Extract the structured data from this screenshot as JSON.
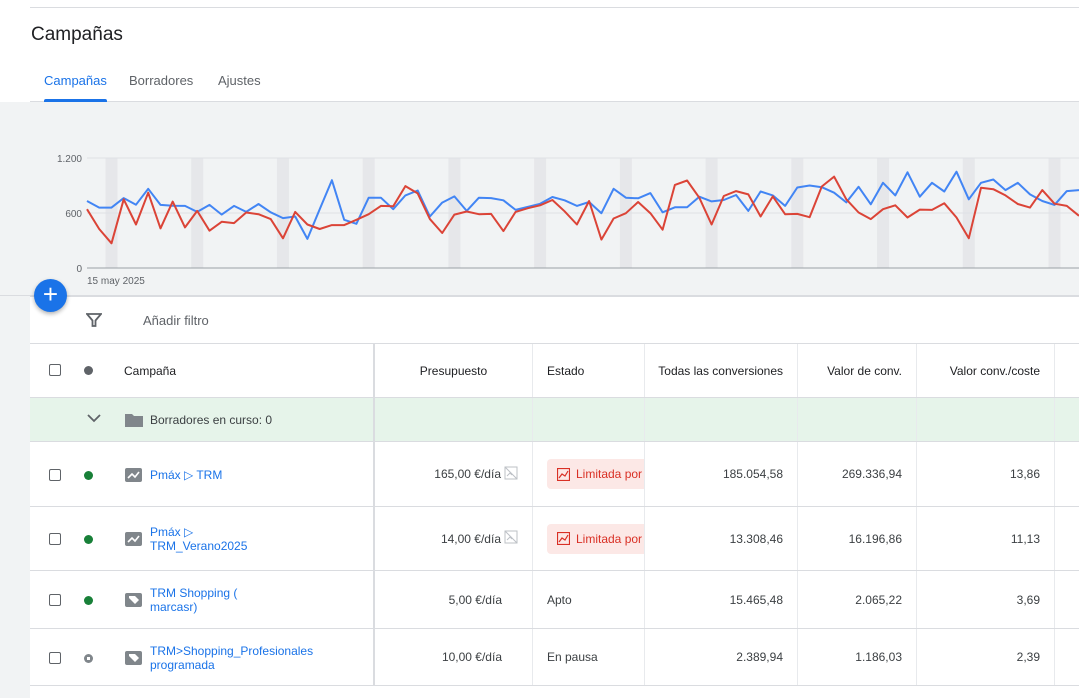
{
  "header": {
    "title": "Campañas"
  },
  "tabs": [
    {
      "label": "Campañas",
      "active": true
    },
    {
      "label": "Borradores"
    },
    {
      "label": "Ajustes"
    }
  ],
  "colors": {
    "accent": "#1a73e8",
    "series_blue": "#4285f4",
    "series_red": "#db4437",
    "enabled": "#188038",
    "paused": "#80868b",
    "limited_bg": "#fce8e6",
    "limited_text": "#d93025"
  },
  "chart_data": {
    "type": "line",
    "x_start_label": "15 may 2025",
    "x_start": "2025-05-15",
    "yticks": [
      "0",
      "600",
      "1.200"
    ],
    "ylim": [
      0,
      1200
    ],
    "weekend_bands": true,
    "series": [
      {
        "color": "#4285f4",
        "values": [
          731,
          659,
          659,
          763,
          691,
          864,
          688,
          680,
          677,
          612,
          688,
          583,
          677,
          612,
          698,
          608,
          544,
          562,
          317,
          640,
          958,
          526,
          482,
          767,
          767,
          641,
          792,
          846,
          562,
          713,
          781,
          623,
          767,
          763,
          738,
          634,
          666,
          700,
          774,
          738,
          677,
          720,
          598,
          864,
          767,
          760,
          817,
          608,
          662,
          662,
          778,
          727,
          742,
          796,
          623,
          835,
          792,
          677,
          878,
          900,
          882,
          821,
          716,
          886,
          695,
          929,
          792,
          1044,
          778,
          929,
          835,
          1051,
          749,
          929,
          965,
          850,
          929,
          803,
          731,
          688,
          839,
          850
        ]
      },
      {
        "color": "#db4437",
        "values": [
          641,
          425,
          270,
          749,
          475,
          821,
          432,
          724,
          443,
          623,
          407,
          504,
          490,
          605,
          587,
          533,
          324,
          612,
          475,
          425,
          468,
          468,
          526,
          587,
          677,
          673,
          893,
          814,
          533,
          382,
          583,
          616,
          587,
          590,
          403,
          612,
          652,
          684,
          742,
          619,
          475,
          731,
          310,
          540,
          598,
          720,
          598,
          418,
          907,
          954,
          767,
          475,
          785,
          839,
          803,
          562,
          781,
          587,
          590,
          554,
          889,
          997,
          749,
          605,
          533,
          641,
          684,
          551,
          637,
          634,
          706,
          551,
          324,
          875,
          860,
          792,
          698,
          659,
          850,
          702,
          677,
          569
        ]
      }
    ]
  },
  "fab": {
    "label": "+"
  },
  "filter": {
    "label": "Añadir filtro"
  },
  "table": {
    "columns": [
      "Campaña",
      "Presupuesto",
      "Estado",
      "Todas las conversiones",
      "Valor de conv.",
      "Valor conv./coste"
    ],
    "drafts_label": "Borradores en curso: 0",
    "rows": [
      {
        "name": "Pmáx ▷ TRM",
        "type": "pmax",
        "status": "enabled",
        "budget": "165,00 €/día",
        "estado": "Limitada por",
        "limited": true,
        "conv": "185.054,58",
        "value": "269.336,94",
        "roas": "13,86"
      },
      {
        "name": "Pmáx ▷ TRM_Verano2025",
        "type": "pmax",
        "status": "enabled",
        "budget": "14,00 €/día",
        "estado": "Limitada por",
        "limited": true,
        "conv": "13.308,46",
        "value": "16.196,86",
        "roas": "11,13"
      },
      {
        "name": "TRM Shopping ( marcasr)",
        "type": "shopping",
        "status": "enabled",
        "budget": "5,00 €/día",
        "estado": "Apto",
        "limited": false,
        "conv": "15.465,48",
        "value": "2.065,22",
        "roas": "3,69"
      },
      {
        "name": "TRM>Shopping_Profesionales programada",
        "type": "shopping",
        "status": "paused",
        "budget": "10,00 €/día",
        "estado": "En pausa",
        "limited": false,
        "conv": "2.389,94",
        "value": "1.186,03",
        "roas": "2,39"
      }
    ]
  }
}
